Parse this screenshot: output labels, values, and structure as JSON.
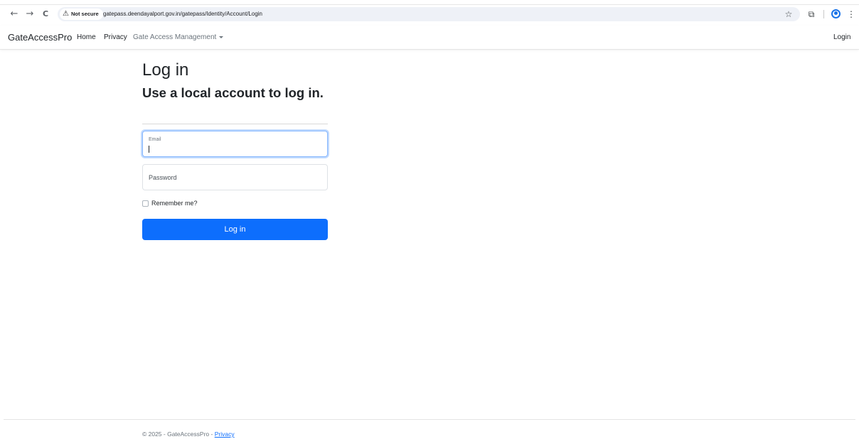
{
  "browser": {
    "back_icon": "back-arrow-icon",
    "back_glyph": "←",
    "forward_glyph": "→",
    "reload_glyph": "C",
    "security_label": "Not secure",
    "warning_glyph": "⚠",
    "url": "gatepass.deendayalport.gov.in/gatepass/Identity/Account/Login",
    "star_glyph": "☆",
    "extensions_glyph": "⧉",
    "menu_glyph": "⋮"
  },
  "navbar": {
    "brand": "GateAccessPro",
    "links": [
      {
        "label": "Home"
      },
      {
        "label": "Privacy"
      },
      {
        "label": "Gate Access Management"
      }
    ],
    "login": "Login"
  },
  "form": {
    "title": "Log in",
    "subtitle": "Use a local account to log in.",
    "email_label": "Email",
    "email_value": "",
    "password_label": "Password",
    "remember_label": "Remember me?",
    "remember_checked": false,
    "submit_label": "Log in"
  },
  "footer": {
    "text": "© 2025 - GateAccessPro - ",
    "privacy_link": "Privacy"
  },
  "colors": {
    "primary": "#0d6efd",
    "focus_border": "#86b7fe",
    "muted_text": "#6c757d"
  }
}
